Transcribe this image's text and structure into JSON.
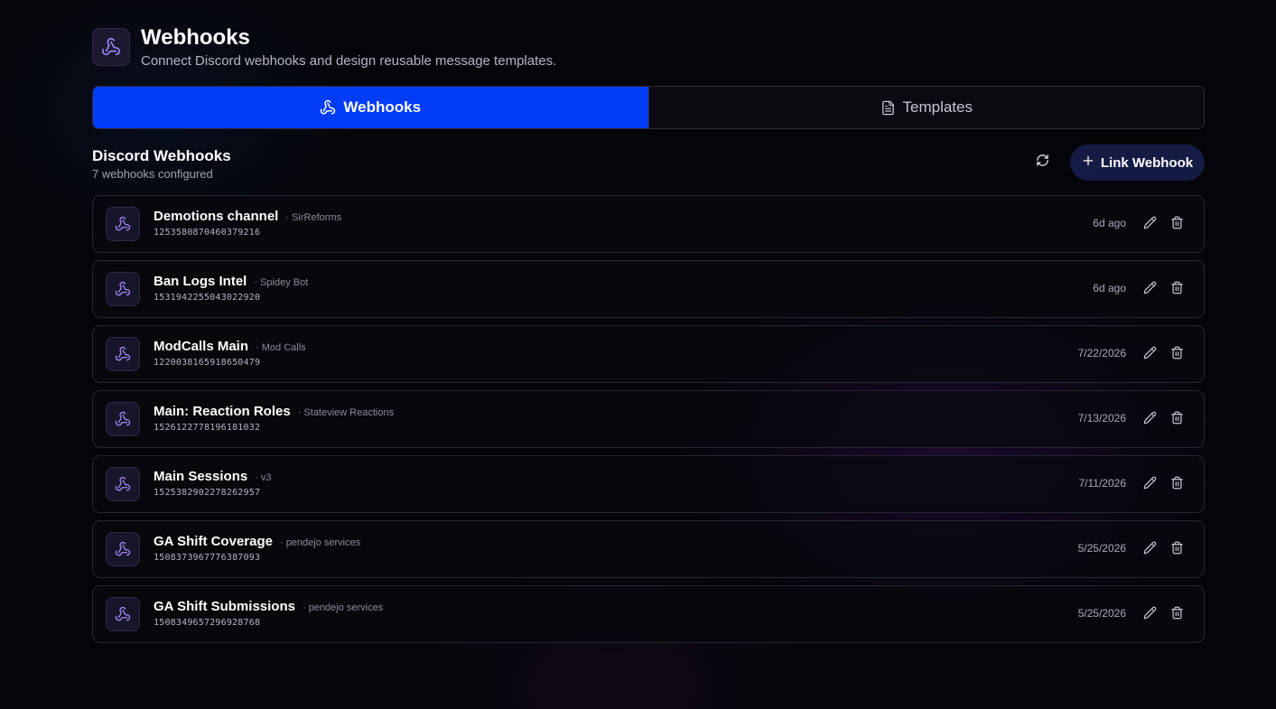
{
  "header": {
    "icon": "webhook-icon",
    "title": "Webhooks",
    "subtitle": "Connect Discord webhooks and design reusable message templates."
  },
  "tabs": [
    {
      "label": "Webhooks",
      "icon": "webhook-icon",
      "active": true
    },
    {
      "label": "Templates",
      "icon": "document-icon",
      "active": false
    }
  ],
  "section": {
    "title": "Discord Webhooks",
    "subtitle": "7 webhooks configured",
    "refresh_icon": "refresh-icon",
    "link_button": {
      "label": "Link Webhook",
      "icon": "plus-icon"
    }
  },
  "webhooks": [
    {
      "name": "Demotions channel",
      "owner": "· SirReforms",
      "id": "1253580870460379216",
      "date": "6d ago"
    },
    {
      "name": "Ban Logs Intel",
      "owner": "· Spidey Bot",
      "id": "1531942255043022920",
      "date": "6d ago"
    },
    {
      "name": "ModCalls Main",
      "owner": "· Mod Calls",
      "id": "1220038165918650479",
      "date": "7/22/2026"
    },
    {
      "name": "Main: Reaction Roles",
      "owner": "· Stateview Reactions",
      "id": "1526122778196181032",
      "date": "7/13/2026"
    },
    {
      "name": "Main Sessions",
      "owner": "· v3",
      "id": "1525382902278262957",
      "date": "7/11/2026"
    },
    {
      "name": "GA Shift Coverage",
      "owner": "· pendejo services",
      "id": "1508373967776387093",
      "date": "5/25/2026"
    },
    {
      "name": "GA Shift Submissions",
      "owner": "· pendejo services",
      "id": "1508349657296928768",
      "date": "5/25/2026"
    }
  ],
  "colors": {
    "accent": "#023cf7",
    "background": "#050509",
    "icon_purple": "#a68cff",
    "link_button_bg": "#141c45"
  }
}
